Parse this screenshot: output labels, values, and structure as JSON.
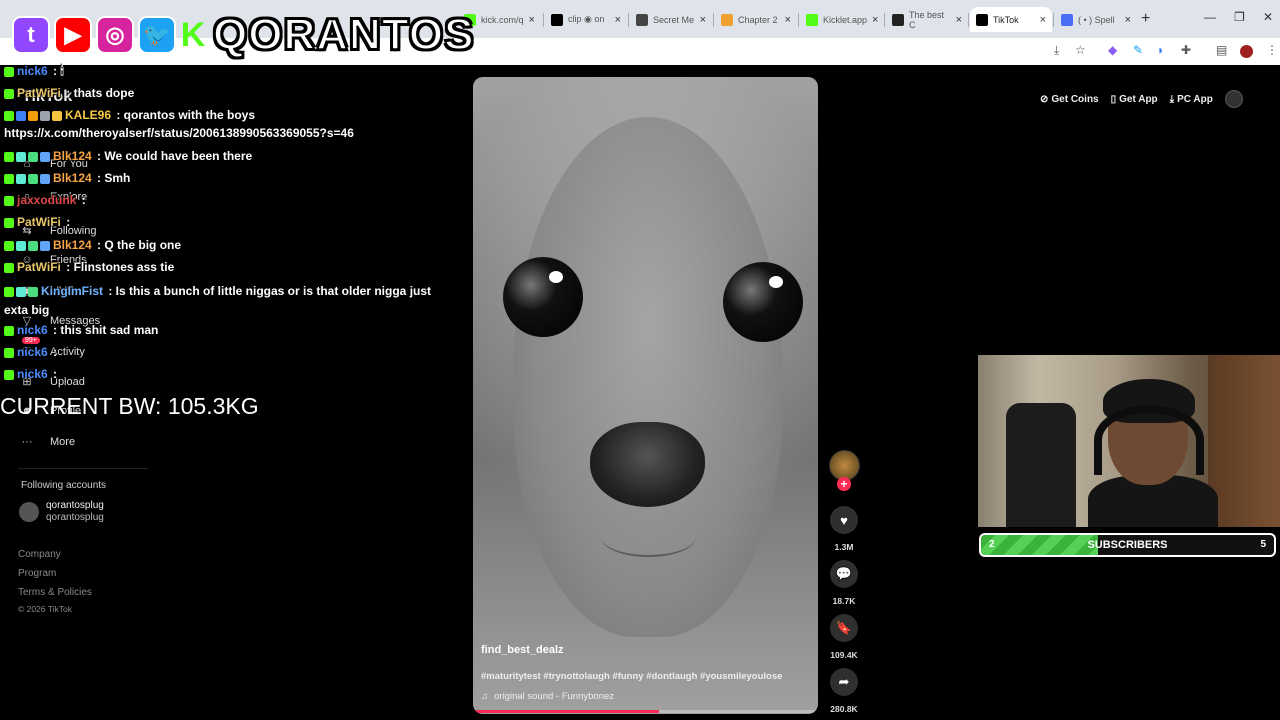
{
  "browser": {
    "tabs": [
      {
        "label": "kick.com/q",
        "color": "#53fc18"
      },
      {
        "label": "clip ◉ on",
        "color": "#000000"
      },
      {
        "label": "Secret Me",
        "color": "#444444"
      },
      {
        "label": "Chapter 2",
        "color": "#f0a030"
      },
      {
        "label": "Kicklet.app",
        "color": "#53fc18"
      },
      {
        "label": "The best C",
        "color": "#222222"
      },
      {
        "label": "TikTok",
        "color": "#000000"
      },
      {
        "label": "( • ) Spell",
        "color": "#4a6cf7"
      }
    ],
    "new_tab": "+",
    "window_controls": [
      "—",
      "❐",
      "✕"
    ]
  },
  "banner": {
    "brand": "QORANTOS",
    "icons": [
      {
        "name": "twitch-icon",
        "glyph": "t",
        "color": "#9146ff"
      },
      {
        "name": "youtube-icon",
        "glyph": "▶",
        "color": "#ff0000"
      },
      {
        "name": "instagram-icon",
        "glyph": "◎",
        "color": "#d6249f"
      },
      {
        "name": "twitter-icon",
        "glyph": "🐦",
        "color": "#1da1f2"
      },
      {
        "name": "kick-icon",
        "glyph": "K",
        "color": "#53fc18"
      }
    ]
  },
  "sidebar": {
    "logo": "TikTok",
    "items": [
      {
        "label": "For You",
        "icon": "⌂",
        "name": "home-icon"
      },
      {
        "label": "Explore",
        "icon": "⌕",
        "name": "explore-icon"
      },
      {
        "label": "Following",
        "icon": "⇆",
        "name": "following-icon"
      },
      {
        "label": "Friends",
        "icon": "☺",
        "name": "friends-icon"
      },
      {
        "label": "LIVE",
        "icon": "▣",
        "name": "live-icon"
      },
      {
        "label": "Messages",
        "icon": "▽",
        "name": "messages-icon"
      },
      {
        "label": "Activity",
        "icon": "♡",
        "name": "activity-icon",
        "badge": "99+"
      },
      {
        "label": "Upload",
        "icon": "⊞",
        "name": "upload-icon"
      },
      {
        "label": "Profile",
        "icon": "☻",
        "name": "profile-icon"
      },
      {
        "label": "More",
        "icon": "···",
        "name": "more-icon"
      }
    ],
    "following_title": "Following accounts",
    "account_name": "qorantosplug",
    "account_handle": "qorantosplug",
    "footer": [
      "Company",
      "Program",
      "Terms & Policies",
      "© 2026 TikTok"
    ]
  },
  "chat": [
    {
      "user": "nick6",
      "user_color": "#4a8cff",
      "text": " : 🕯",
      "badges": [
        "#53fc18"
      ]
    },
    {
      "user": "PatWiFi",
      "user_color": "#e8c66a",
      "text": " : thats dope",
      "badges": [
        "#53fc18"
      ]
    },
    {
      "user": "KALE96",
      "user_color": "#f7c948",
      "text": " : qorantos with the boys",
      "badges": [
        "#53fc18",
        "#3b82f6",
        "#f59e0b",
        "#9ca3af",
        "#f5c542"
      ]
    },
    {
      "user": "",
      "user_color": "#ffffff",
      "text": "https://x.com/theroyalserf/status/2006138990563369055?s=46",
      "badges": []
    },
    {
      "user": "Blk124",
      "user_color": "#f7a348",
      "text": " : We could have been there",
      "badges": [
        "#53fc18",
        "#5eead4",
        "#4ade80",
        "#60a5fa"
      ]
    },
    {
      "user": "Blk124",
      "user_color": "#f7a348",
      "text": " : Smh",
      "badges": [
        "#53fc18",
        "#5eead4",
        "#4ade80",
        "#60a5fa"
      ]
    },
    {
      "user": "jaxxodunk",
      "user_color": "#e04848",
      "text": " : ",
      "badges": [
        "#53fc18"
      ]
    },
    {
      "user": "PatWiFi",
      "user_color": "#e8c66a",
      "text": " : ",
      "badges": [
        "#53fc18"
      ]
    },
    {
      "user": "Blk124",
      "user_color": "#f7a348",
      "text": " : Q the big one",
      "badges": [
        "#53fc18",
        "#5eead4",
        "#4ade80",
        "#60a5fa"
      ]
    },
    {
      "user": "PatWiFi",
      "user_color": "#e8c66a",
      "text": " : Flinstones ass tie",
      "badges": [
        "#53fc18"
      ]
    },
    {
      "user": "KingImFist",
      "user_color": "#6fb3ff",
      "text": " : Is this a bunch of little niggas or is that older nigga just exta big",
      "badges": [
        "#53fc18",
        "#5eead4",
        "#4ade80"
      ]
    },
    {
      "user": "nick6",
      "user_color": "#4a8cff",
      "text": " : this shit sad man",
      "badges": [
        "#53fc18"
      ]
    },
    {
      "user": "nick6",
      "user_color": "#4a8cff",
      "text": " : ",
      "badges": [
        "#53fc18"
      ]
    },
    {
      "user": "nick6",
      "user_color": "#4a8cff",
      "text": " : ",
      "badges": [
        "#53fc18"
      ]
    }
  ],
  "overlay": {
    "bw": "CURRENT BW: 105.3KG"
  },
  "video": {
    "username": "find_best_dealz",
    "tags": "#maturitytest #trynottolaugh #funny #dontlaugh #yousmileyoulose",
    "sound": "original sound - Funnybonez",
    "progress": 0.54
  },
  "actions": {
    "likes": "1.3M",
    "comments": "18.7K",
    "saves": "109.4K",
    "shares": "280.8K"
  },
  "header": {
    "get_coins": "Get Coins",
    "get_app": "Get App",
    "pc_app": "PC App"
  },
  "goal": {
    "current": "2",
    "title": "SUBSCRIBERS",
    "target": "5",
    "progress": 0.4
  }
}
